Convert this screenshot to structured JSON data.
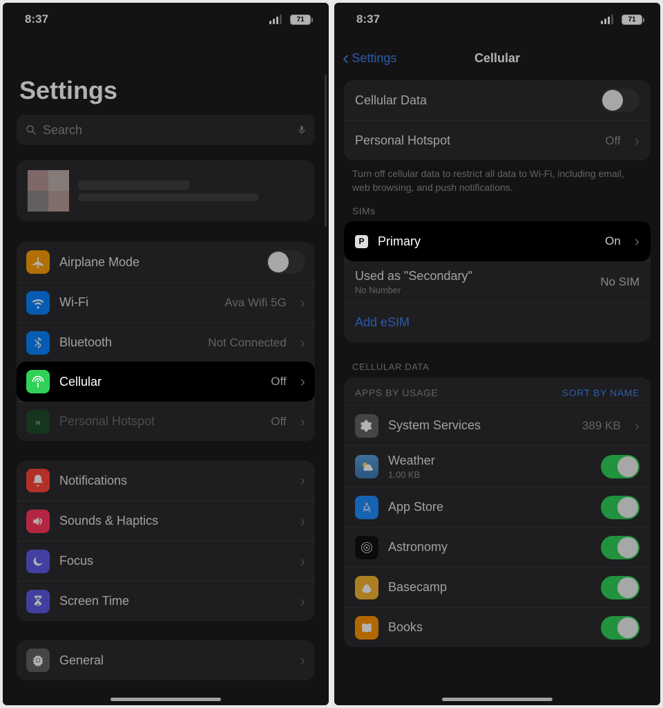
{
  "status": {
    "time": "8:37",
    "battery": "71"
  },
  "left": {
    "title": "Settings",
    "search_placeholder": "Search",
    "rows": {
      "airplane": "Airplane Mode",
      "wifi": "Wi-Fi",
      "wifi_value": "Ava Wifi 5G",
      "bluetooth": "Bluetooth",
      "bluetooth_value": "Not Connected",
      "cellular": "Cellular",
      "cellular_value": "Off",
      "hotspot": "Personal Hotspot",
      "hotspot_value": "Off",
      "notifications": "Notifications",
      "sounds": "Sounds & Haptics",
      "focus": "Focus",
      "screentime": "Screen Time",
      "general": "General"
    }
  },
  "right": {
    "back": "Settings",
    "title": "Cellular",
    "cellular_data": "Cellular Data",
    "hotspot": "Personal Hotspot",
    "hotspot_value": "Off",
    "note": "Turn off cellular data to restrict all data to Wi-Fi, including email, web browsing, and push notifications.",
    "sims_header": "SIMs",
    "primary": "Primary",
    "primary_badge": "P",
    "primary_value": "On",
    "secondary_title": "Used as \"Secondary\"",
    "secondary_sub": "No Number",
    "secondary_value": "No SIM",
    "add_esim": "Add eSIM",
    "cell_data_header": "CELLULAR DATA",
    "apps_header": "APPS BY USAGE",
    "sort": "SORT BY NAME",
    "apps": {
      "system": {
        "name": "System Services",
        "value": "389 KB"
      },
      "weather": {
        "name": "Weather",
        "sub": "1.00 KB"
      },
      "appstore": {
        "name": "App Store"
      },
      "astronomy": {
        "name": "Astronomy"
      },
      "basecamp": {
        "name": "Basecamp"
      },
      "books": {
        "name": "Books"
      }
    }
  }
}
